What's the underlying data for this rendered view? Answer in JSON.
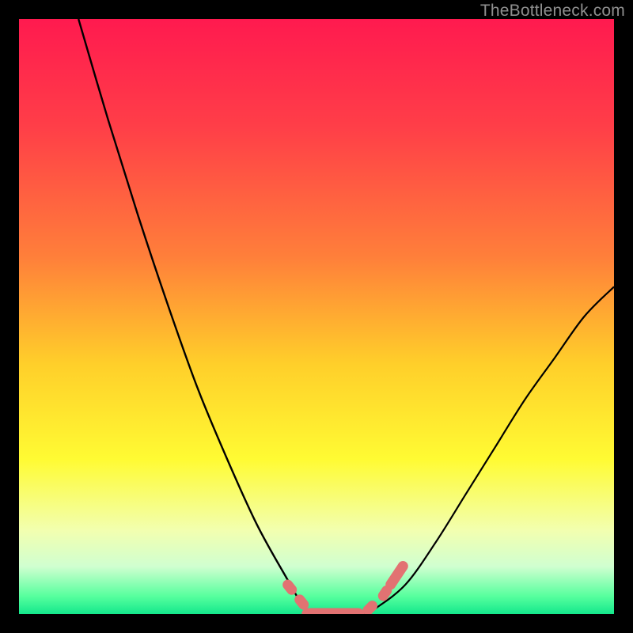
{
  "watermark": "TheBottleneck.com",
  "chart_data": {
    "type": "line",
    "title": "",
    "xlabel": "",
    "ylabel": "",
    "xlim": [
      0,
      100
    ],
    "ylim": [
      0,
      100
    ],
    "grid": false,
    "legend": false,
    "series": [
      {
        "name": "left-curve",
        "x": [
          10,
          15,
          20,
          25,
          30,
          35,
          40,
          45,
          48,
          50
        ],
        "y": [
          100,
          83,
          67,
          52,
          38,
          26,
          15,
          6,
          1,
          0
        ]
      },
      {
        "name": "right-curve",
        "x": [
          58,
          60,
          65,
          70,
          75,
          80,
          85,
          90,
          95,
          100
        ],
        "y": [
          0,
          1,
          5,
          12,
          20,
          28,
          36,
          43,
          50,
          55
        ]
      }
    ],
    "markers": [
      {
        "name": "left-dots",
        "x": [
          45.5,
          47.5
        ],
        "y": [
          4.5,
          2
        ]
      },
      {
        "name": "bottom-pill",
        "x_range": [
          48.5,
          57
        ],
        "y": 0
      },
      {
        "name": "right-dots",
        "x": [
          59,
          61.5,
          63.5
        ],
        "y": [
          1,
          3.5,
          6.5
        ]
      }
    ],
    "gradient_stops": [
      {
        "offset": 0,
        "color": "#ff1a4f"
      },
      {
        "offset": 18,
        "color": "#ff3e48"
      },
      {
        "offset": 40,
        "color": "#ff7f3a"
      },
      {
        "offset": 58,
        "color": "#ffcf2a"
      },
      {
        "offset": 74,
        "color": "#fffb33"
      },
      {
        "offset": 86,
        "color": "#f2ffb0"
      },
      {
        "offset": 92,
        "color": "#d0ffd0"
      },
      {
        "offset": 97,
        "color": "#57ff9e"
      },
      {
        "offset": 100,
        "color": "#14e88c"
      }
    ],
    "marker_color": "#e27272",
    "curve_color": "#000000"
  }
}
